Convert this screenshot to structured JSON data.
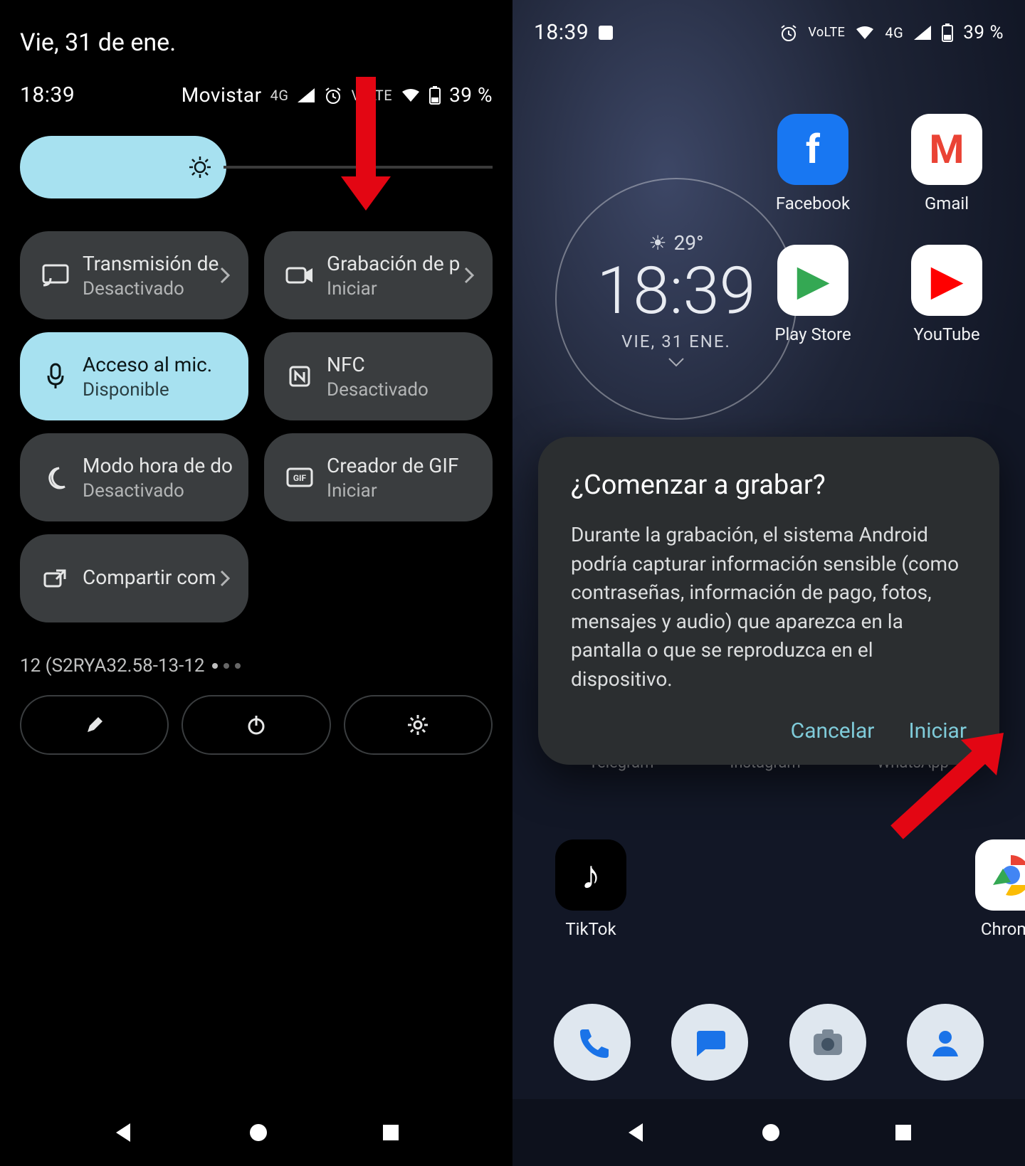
{
  "left": {
    "date": "Vie, 31 de ene.",
    "time": "18:39",
    "carrier": "Movistar",
    "net": "4G",
    "battery": "39 %",
    "tiles": [
      {
        "title": "Transmisión de",
        "sub": "Desactivado",
        "icon": "cast-icon",
        "active": false,
        "chev": true
      },
      {
        "title": "Grabación de p",
        "sub": "Iniciar",
        "icon": "record-icon",
        "active": false,
        "chev": true
      },
      {
        "title": "Acceso al mic.",
        "sub": "Disponible",
        "icon": "mic-icon",
        "active": true,
        "chev": false
      },
      {
        "title": "NFC",
        "sub": "Desactivado",
        "icon": "nfc-icon",
        "active": false,
        "chev": false
      },
      {
        "title": "Modo hora de dor",
        "sub": "Desactivado",
        "icon": "bedtime-icon",
        "active": false,
        "chev": false
      },
      {
        "title": "Creador de GIF",
        "sub": "Iniciar",
        "icon": "gif-icon",
        "active": false,
        "chev": false
      },
      {
        "title": "Compartir com",
        "sub": "",
        "icon": "share-icon",
        "active": false,
        "chev": true
      }
    ],
    "build": "12 (S2RYA32.58-13-12"
  },
  "right": {
    "time": "18:39",
    "battery": "39 %",
    "net": "4G",
    "widget": {
      "temp": "29°",
      "time": "18:39",
      "date": "VIE, 31 ENE."
    },
    "apps": [
      {
        "name": "Facebook",
        "icon": "facebook-icon",
        "bg": "#1877F2",
        "fg": "#fff",
        "glyph": "f"
      },
      {
        "name": "Gmail",
        "icon": "gmail-icon",
        "bg": "#ffffff",
        "fg": "#EA4335",
        "glyph": "M"
      },
      {
        "name": "Play Store",
        "icon": "playstore-icon",
        "bg": "#ffffff",
        "fg": "#34A853",
        "glyph": "▶"
      },
      {
        "name": "YouTube",
        "icon": "youtube-icon",
        "bg": "#ffffff",
        "fg": "#FF0000",
        "glyph": "▶"
      }
    ],
    "mid_labels": [
      "Telegram",
      "Instagram",
      "WhatsApp"
    ],
    "tiktok": {
      "name": "TikTok"
    },
    "chrome": {
      "name": "Chrome"
    },
    "dialog": {
      "title": "¿Comenzar a grabar?",
      "body": "Durante la grabación, el sistema Android podría capturar información sensible (como contraseñas, información de pago, fotos, mensajes y audio) que aparezca en la pantalla o que se reproduzca en el dispositivo.",
      "cancel": "Cancelar",
      "start": "Iniciar"
    }
  }
}
